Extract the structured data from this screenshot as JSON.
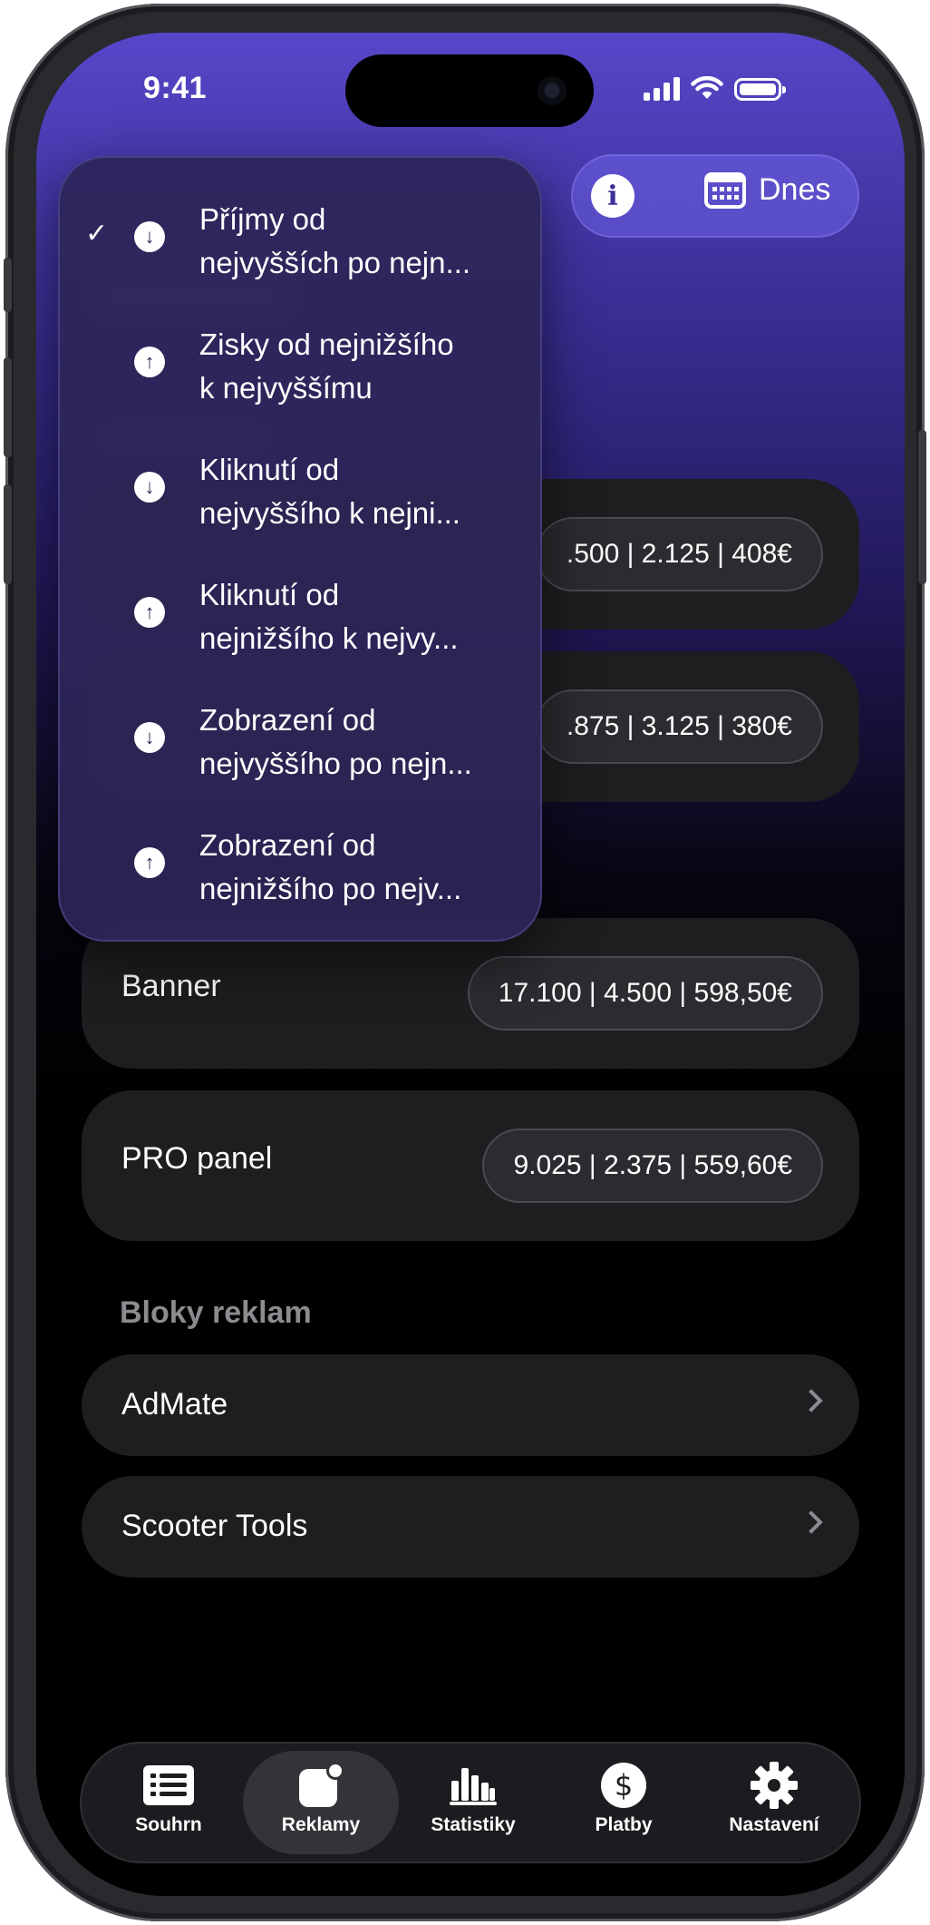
{
  "status_bar": {
    "time": "9:41"
  },
  "header": {
    "today_label": "Dnes"
  },
  "sort_menu": {
    "items": [
      {
        "line1": "Příjmy od",
        "line2": "nejvyšších po nejn...",
        "direction": "down",
        "selected": true
      },
      {
        "line1": "Zisky od nejnižšího",
        "line2": "k nejvyššímu",
        "direction": "up",
        "selected": false
      },
      {
        "line1": "Kliknutí od",
        "line2": "nejvyššího k nejni...",
        "direction": "down",
        "selected": false
      },
      {
        "line1": "Kliknutí od",
        "line2": "nejnižšího k nejvy...",
        "direction": "up",
        "selected": false
      },
      {
        "line1": "Zobrazení od",
        "line2": "nejvyššího po nejn...",
        "direction": "down",
        "selected": false
      },
      {
        "line1": "Zobrazení od",
        "line2": "nejnižšího po nejv...",
        "direction": "up",
        "selected": false
      }
    ],
    "check_glyph": "✓"
  },
  "placements": [
    {
      "label": "",
      "stats": ".500 | 2.125 | 408€"
    },
    {
      "label": "",
      "stats": ".875 | 3.125 | 380€"
    },
    {
      "label": "Banner",
      "stats": "17.100 | 4.500 | 598,50€"
    },
    {
      "label": "PRO panel",
      "stats": "9.025 | 2.375 | 559,60€"
    }
  ],
  "ad_blocks": {
    "title": "Bloky reklam",
    "items": [
      {
        "label": "AdMate"
      },
      {
        "label": "Scooter Tools"
      }
    ]
  },
  "tab_bar": {
    "tabs": [
      {
        "label": "Souhrn",
        "icon": "list-icon",
        "active": false
      },
      {
        "label": "Reklamy",
        "icon": "ads-icon",
        "active": true
      },
      {
        "label": "Statistiky",
        "icon": "bar-chart-icon",
        "active": false
      },
      {
        "label": "Platby",
        "icon": "dollar-icon",
        "active": false
      },
      {
        "label": "Nastavení",
        "icon": "gear-icon",
        "active": false
      }
    ]
  },
  "colors": {
    "accent": "#5647c9",
    "card": "#1e1e21",
    "text": "#ffffff",
    "muted": "#8b8b90"
  }
}
